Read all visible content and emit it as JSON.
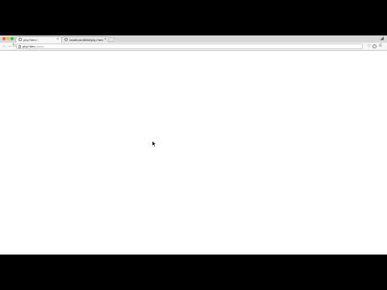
{
  "browser": {
    "tabs": [
      {
        "title": "php?dev=",
        "active": true
      },
      {
        "title": "localhost:8888/php?dev=",
        "active": false
      }
    ],
    "url": {
      "host": "php?dev",
      "path": "=www"
    },
    "colors": {
      "close": "#fc5f57",
      "minimize": "#fdbc2e",
      "maximize": "#28c840"
    }
  }
}
